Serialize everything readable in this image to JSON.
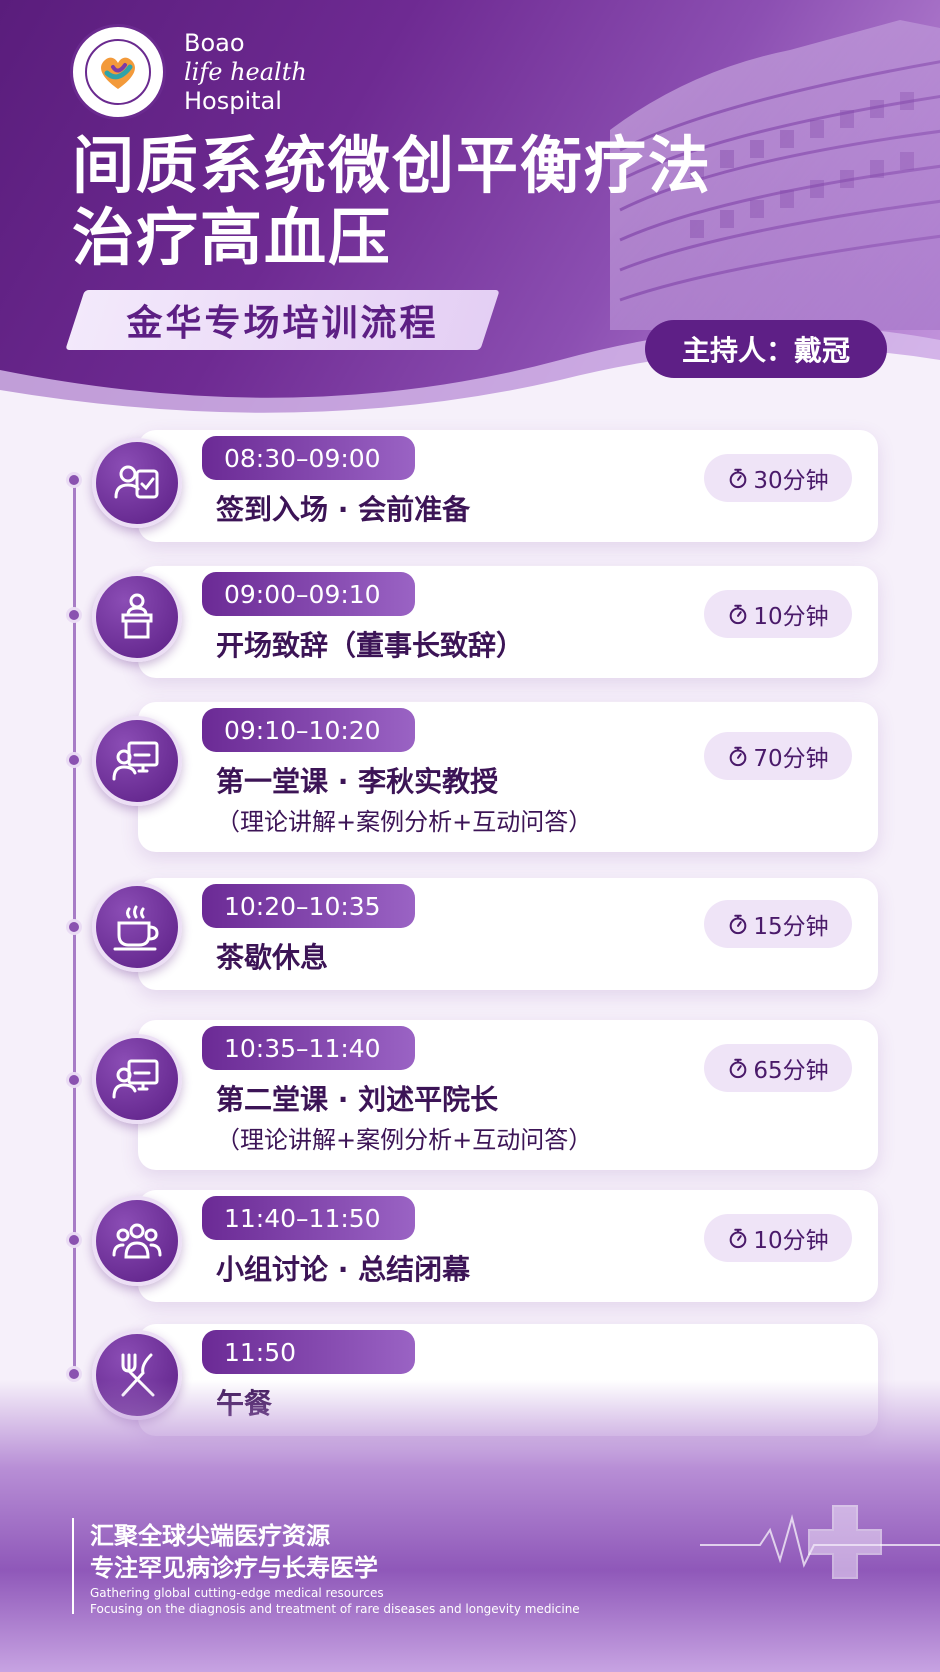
{
  "hospital": {
    "name_line1": "Boao",
    "name_line2": "life health",
    "name_line3": "Hospital"
  },
  "title": {
    "line1": "间质系统微创平衡疗法",
    "line2": "治疗高血压"
  },
  "subtitle": "金华专场培训流程",
  "host": "主持人：戴冠",
  "schedule": [
    {
      "time": "08:30–09:00",
      "title": "签到入场 · 会前准备",
      "sub": "",
      "duration": "30分钟",
      "icon": "sign-in-icon"
    },
    {
      "time": "09:00–09:10",
      "title": "开场致辞（董事长致辞）",
      "sub": "",
      "duration": "10分钟",
      "icon": "podium-icon"
    },
    {
      "time": "09:10–10:20",
      "title": "第一堂课 · 李秋实教授",
      "sub": "（理论讲解+案例分析+互动问答）",
      "duration": "70分钟",
      "icon": "lecture-icon"
    },
    {
      "time": "10:20–10:35",
      "title": "茶歇休息",
      "sub": "",
      "duration": "15分钟",
      "icon": "coffee-icon"
    },
    {
      "time": "10:35–11:40",
      "title": "第二堂课 · 刘述平院长",
      "sub": "（理论讲解+案例分析+互动问答）",
      "duration": "65分钟",
      "icon": "lecture-icon"
    },
    {
      "time": "11:40–11:50",
      "title": "小组讨论 · 总结闭幕",
      "sub": "",
      "duration": "10分钟",
      "icon": "group-icon"
    },
    {
      "time": "11:50",
      "title": "午餐",
      "sub": "",
      "duration": "",
      "icon": "cutlery-icon"
    }
  ],
  "footer": {
    "slogan1": "汇聚全球尖端医疗资源",
    "slogan2": "专注罕见病诊疗与长寿医学",
    "english1": "Gathering global cutting-edge medical resources",
    "english2": "Focusing on the diagnosis and treatment of rare diseases and longevity medicine"
  },
  "colors": {
    "primary": "#5e1f86",
    "accent": "#8a52b0",
    "pill_bg": "#efe4f7"
  }
}
